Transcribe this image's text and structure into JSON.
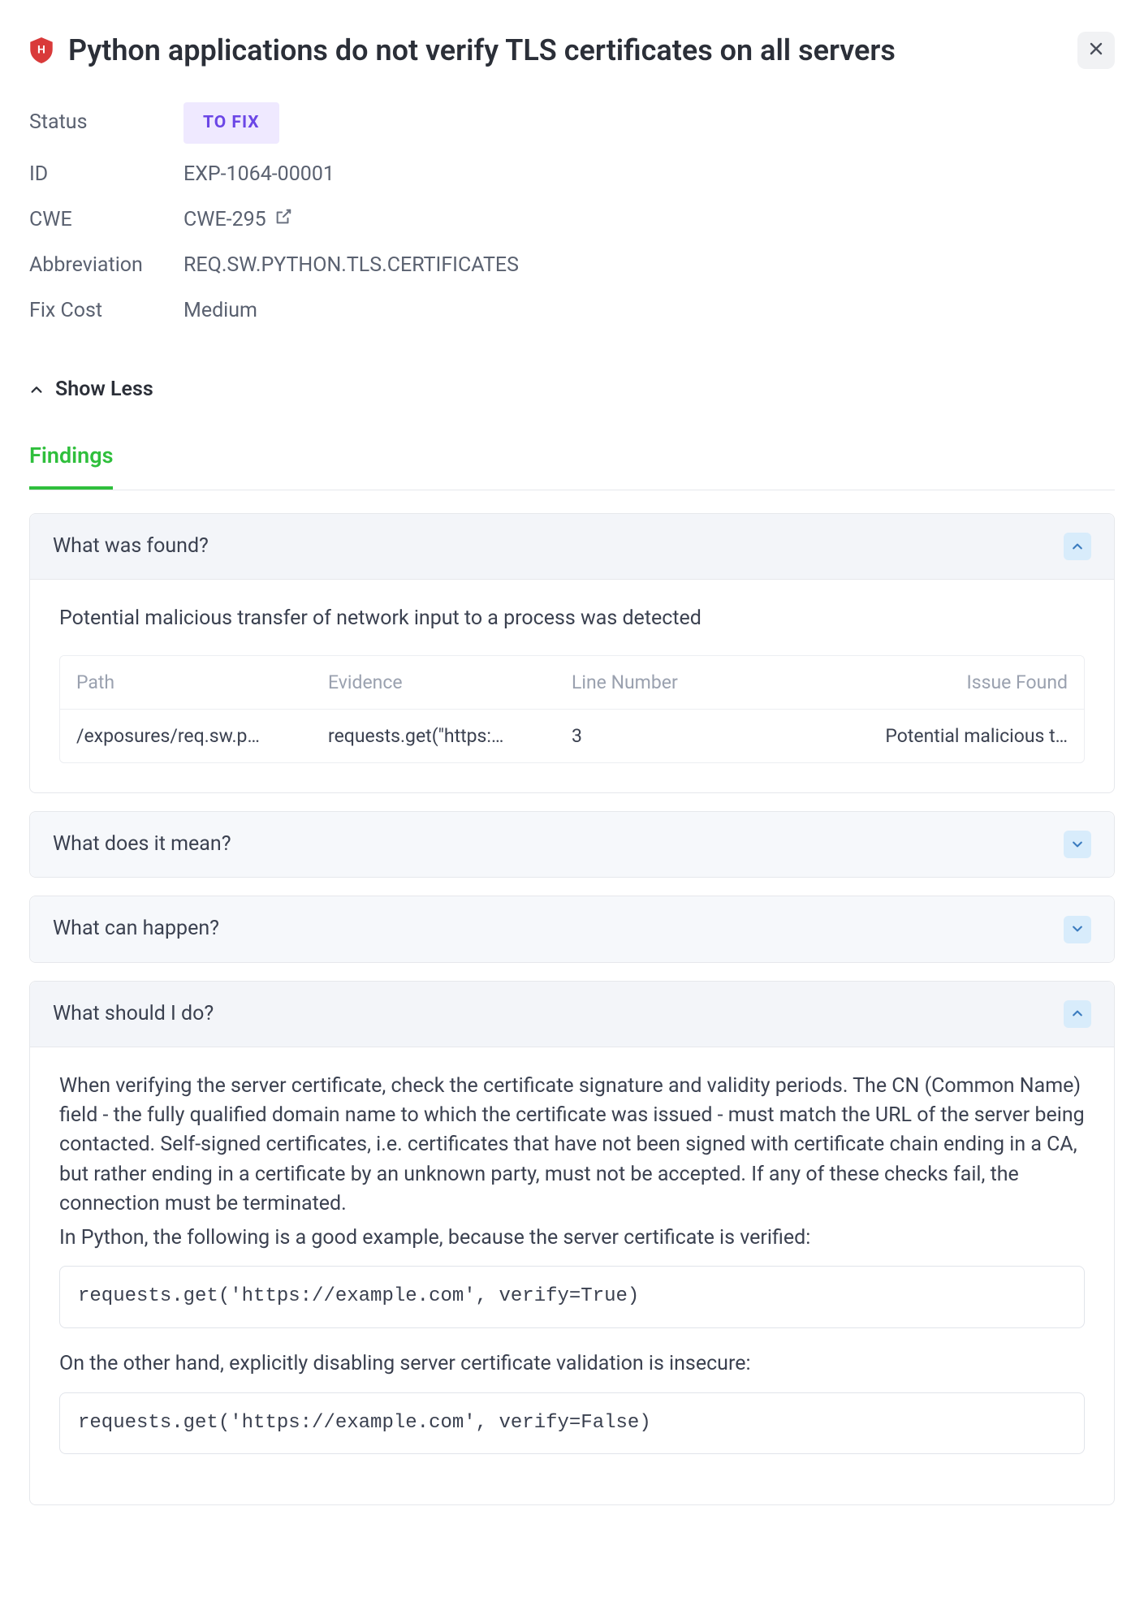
{
  "header": {
    "title": "Python applications do not verify TLS certificates on all servers"
  },
  "meta": {
    "status_label": "Status",
    "status_badge": "TO FIX",
    "id_label": "ID",
    "id_value": "EXP-1064-00001",
    "cwe_label": "CWE",
    "cwe_value": "CWE-295",
    "abbr_label": "Abbreviation",
    "abbr_value": "REQ.SW.PYTHON.TLS.CERTIFICATES",
    "fix_label": "Fix Cost",
    "fix_value": "Medium"
  },
  "show_less": "Show Less",
  "tabs": {
    "findings": "Findings"
  },
  "panels": {
    "found": {
      "title": "What was found?",
      "desc": "Potential malicious transfer of network input to a process was detected",
      "columns": {
        "path": "Path",
        "evidence": "Evidence",
        "line": "Line Number",
        "issue": "Issue Found"
      },
      "row": {
        "path": "/exposures/req.sw.p…",
        "evidence": "requests.get(\"https:…",
        "line": "3",
        "issue": "Potential malicious t…"
      }
    },
    "mean": {
      "title": "What does it mean?"
    },
    "happen": {
      "title": "What can happen?"
    },
    "do": {
      "title": "What should I do?",
      "p1": "When verifying the server certificate, check the certificate signature and validity periods. The CN (Common Name) field - the fully qualified domain name to which the certificate was issued - must match the URL of the server being contacted. Self-signed certificates, i.e. certificates that have not been signed with certificate chain ending in a CA, but rather ending in a certificate by an unknown party, must not be accepted. If any of these checks fail, the connection must be terminated.",
      "p2": "In Python, the following is a good example, because the server certificate is verified:",
      "code1": "requests.get('https://example.com', verify=True)",
      "p3": "On the other hand, explicitly disabling server certificate validation is insecure:",
      "code2": "requests.get('https://example.com', verify=False)"
    }
  }
}
